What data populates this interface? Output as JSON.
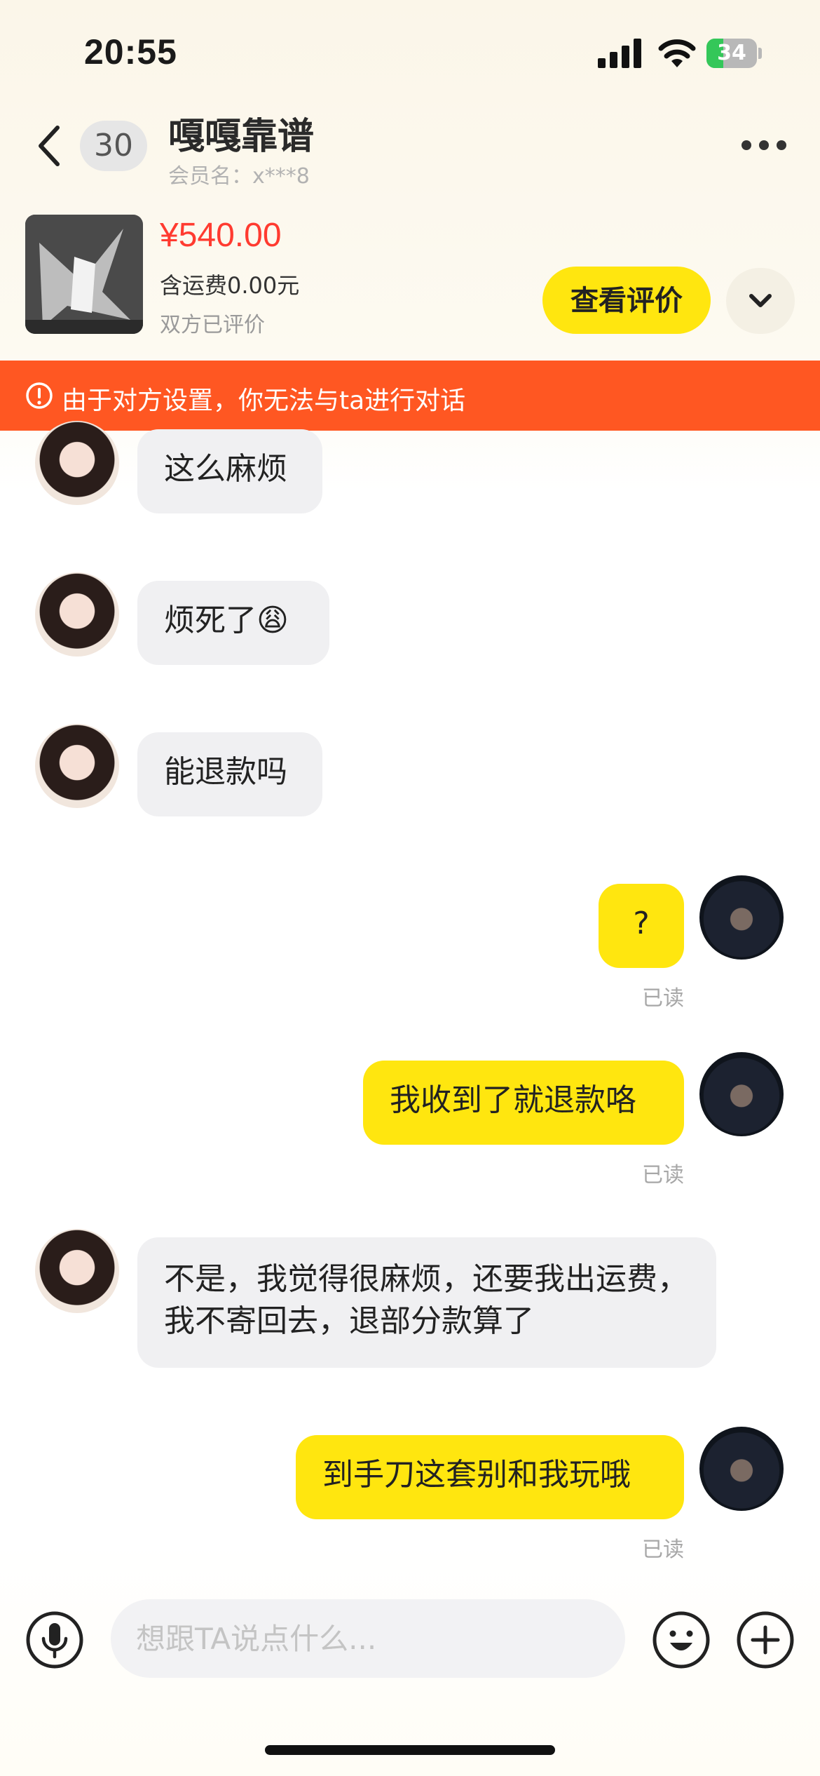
{
  "status_bar": {
    "time": "20:55",
    "battery": "34",
    "battery_level": 0.34
  },
  "header": {
    "unread_count": "30",
    "name": "嘎嘎靠谱",
    "member": "会员名：x***8"
  },
  "product": {
    "price": "¥540.00",
    "shipping": "含运费0.00元",
    "review_status": "双方已评价",
    "review_button": "查看评价"
  },
  "banner": {
    "text": "由于对方设置，你无法与ta进行对话"
  },
  "messages": [
    {
      "from": "other",
      "text": "这么麻烦"
    },
    {
      "from": "other",
      "text": "烦死了😩"
    },
    {
      "from": "other",
      "text": "能退款吗"
    },
    {
      "from": "me",
      "text": "?",
      "status": "已读"
    },
    {
      "from": "me",
      "text": "我收到了就退款咯",
      "status": "已读"
    },
    {
      "from": "other",
      "text": "不是，我觉得很麻烦，还要我出运费，我不寄回去，退部分款算了"
    },
    {
      "from": "me",
      "text": "到手刀这套别和我玩哦",
      "status": "已读"
    }
  ],
  "input": {
    "placeholder": "想跟TA说点什么..."
  },
  "colors": {
    "accent": "#ffe60f",
    "price": "#ff3b30",
    "banner": "#ff5722",
    "bubble_in": "#f0f0f2"
  },
  "icons": [
    "back-arrow-icon",
    "more-dots-icon",
    "chevron-down-icon",
    "warning-icon",
    "microphone-icon",
    "emoji-icon",
    "plus-icon",
    "signal-icon",
    "wifi-icon",
    "battery-icon"
  ]
}
